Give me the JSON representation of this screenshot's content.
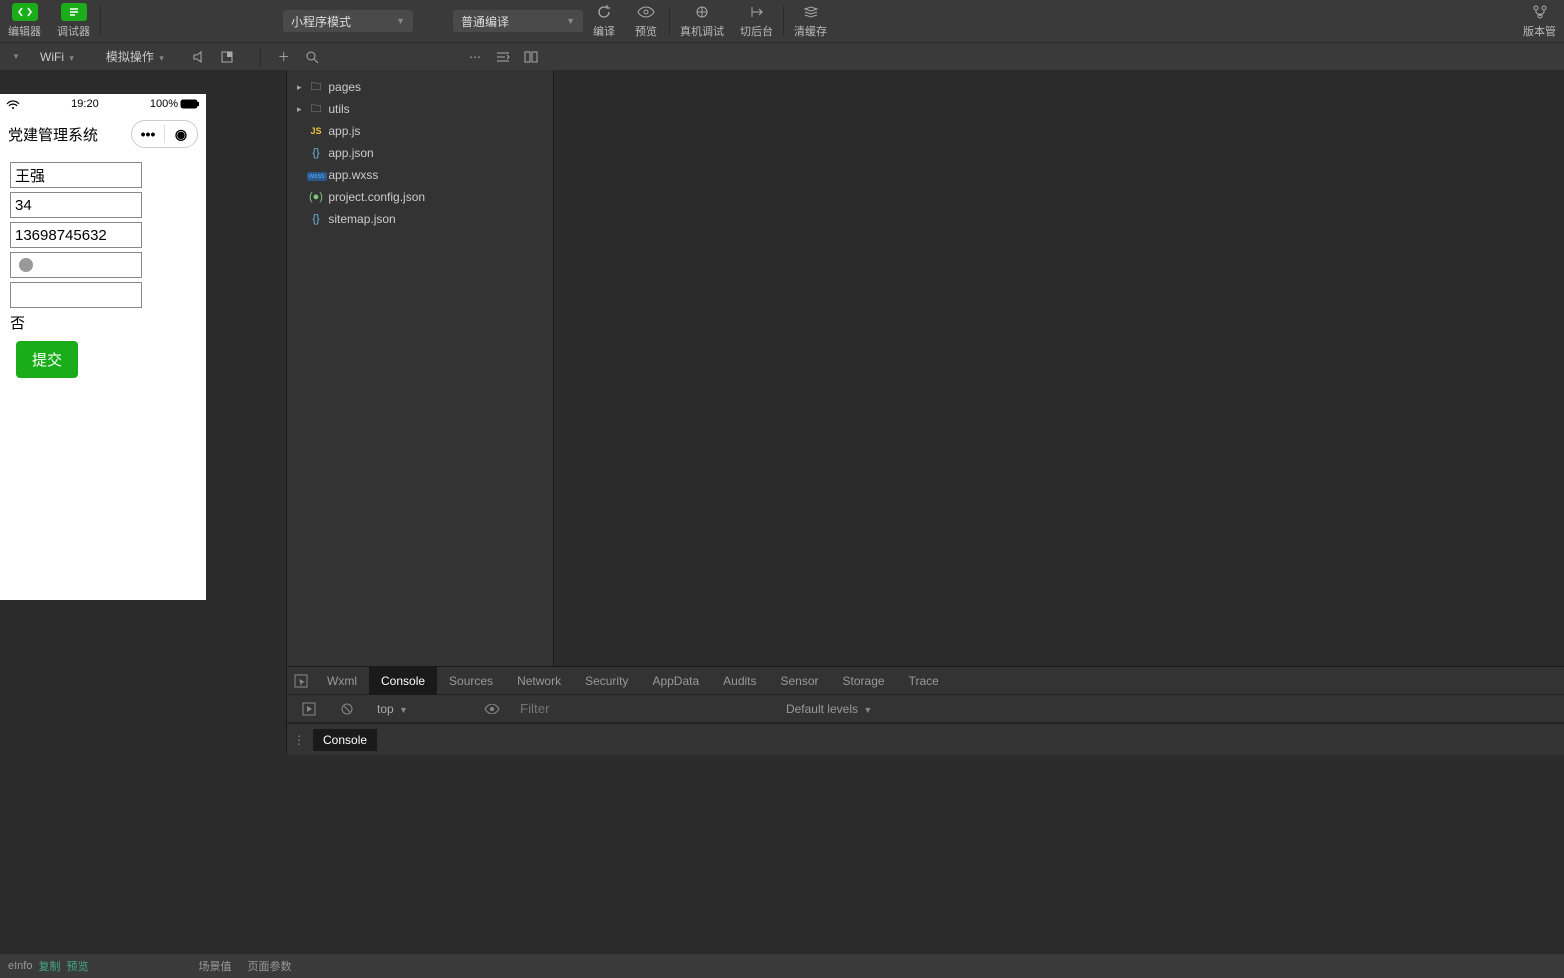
{
  "topbar": {
    "editor": "编辑器",
    "debugger": "调试器",
    "mode": "小程序模式",
    "compileMode": "普通编译",
    "compile": "编译",
    "preview": "预览",
    "remote": "真机调试",
    "background": "切后台",
    "clearCache": "清缓存",
    "version": "版本管"
  },
  "simbar": {
    "network": "WiFi",
    "mock": "模拟操作"
  },
  "phone": {
    "time": "19:20",
    "battery": "100%",
    "title": "党建管理系统",
    "name": "王强",
    "age": "34",
    "phoneNum": "13698745632",
    "boolText": "否",
    "submit": "提交"
  },
  "files": {
    "pages": "pages",
    "utils": "utils",
    "appjs": "app.js",
    "appjson": "app.json",
    "appwxss": "app.wxss",
    "projcfg": "project.config.json",
    "sitemap": "sitemap.json"
  },
  "devtools": {
    "wxml": "Wxml",
    "console": "Console",
    "sources": "Sources",
    "network": "Network",
    "security": "Security",
    "appdata": "AppData",
    "audits": "Audits",
    "sensor": "Sensor",
    "storage": "Storage",
    "trace": "Trace",
    "context": "top",
    "filterPh": "Filter",
    "levels": "Default levels",
    "drawer": "Console"
  },
  "bottom": {
    "info": "eInfo",
    "copy": "复制",
    "preview": "预览",
    "scene": "场景值",
    "pageParams": "页面参数"
  }
}
